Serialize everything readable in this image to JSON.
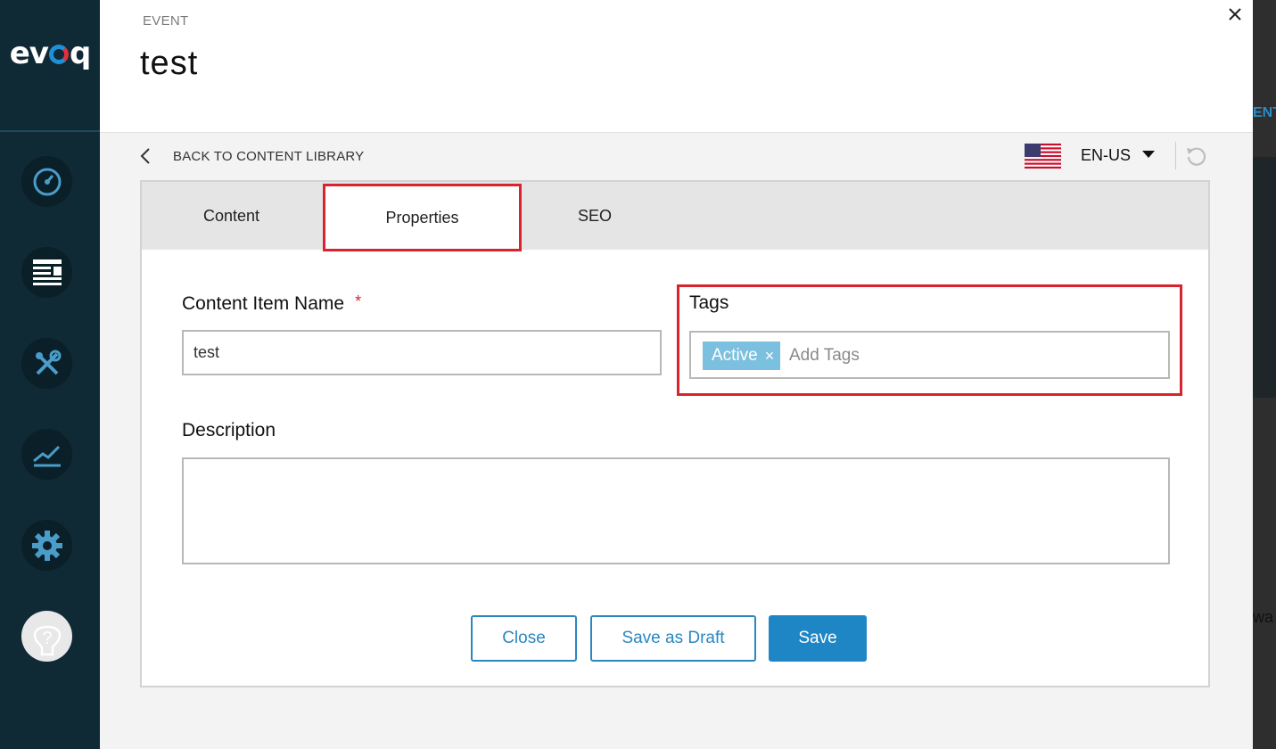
{
  "sidebar": {
    "logo_text": "evoq",
    "nav": [
      {
        "icon": "dashboard-gauge-icon"
      },
      {
        "icon": "content-list-icon"
      },
      {
        "icon": "tools-icon"
      },
      {
        "icon": "analytics-chart-icon"
      },
      {
        "icon": "settings-gear-icon"
      },
      {
        "icon": "help-icon"
      }
    ]
  },
  "background": {
    "peek_text_1": "ENT",
    "peek_text_2": "wa"
  },
  "header": {
    "type_label": "EVENT",
    "title": "test",
    "close_icon": "close-icon"
  },
  "toolbar": {
    "back_label": "BACK TO CONTENT LIBRARY",
    "language": "EN-US",
    "flag": "us-flag-icon"
  },
  "tabs": [
    {
      "label": "Content",
      "active": false
    },
    {
      "label": "Properties",
      "active": true
    },
    {
      "label": "SEO",
      "active": false
    }
  ],
  "form": {
    "name_label": "Content Item Name",
    "required_mark": "*",
    "name_value": "test",
    "tags_label": "Tags",
    "tags": [
      "Active"
    ],
    "tag_remove": "×",
    "tags_placeholder": "Add Tags",
    "description_label": "Description",
    "description_value": ""
  },
  "actions": {
    "close_label": "Close",
    "draft_label": "Save as Draft",
    "save_label": "Save"
  },
  "colors": {
    "sidebar_bg": "#0f2935",
    "accent_blue": "#1f86c6",
    "highlight_red": "#d9232d",
    "tag_chip": "#7cc0df"
  }
}
